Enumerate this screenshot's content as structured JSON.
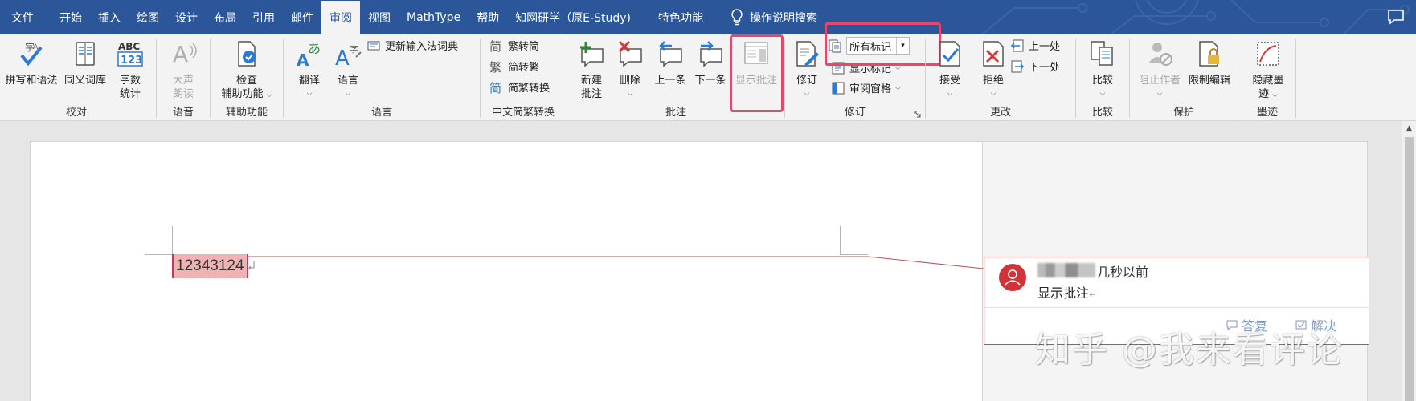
{
  "tabs": [
    {
      "label": "文件",
      "active": false
    },
    {
      "label": "开始",
      "active": false
    },
    {
      "label": "插入",
      "active": false
    },
    {
      "label": "绘图",
      "active": false
    },
    {
      "label": "设计",
      "active": false
    },
    {
      "label": "布局",
      "active": false
    },
    {
      "label": "引用",
      "active": false
    },
    {
      "label": "邮件",
      "active": false
    },
    {
      "label": "审阅",
      "active": true
    },
    {
      "label": "视图",
      "active": false
    },
    {
      "label": "MathType",
      "active": false
    },
    {
      "label": "帮助",
      "active": false
    },
    {
      "label": "知网研学（原E-Study)",
      "active": false
    },
    {
      "label": "特色功能",
      "active": false
    }
  ],
  "tell_me": "操作说明搜索",
  "ribbon": {
    "proofing": {
      "label": "校对",
      "spelling": "拼写和语法",
      "thesaurus": "同义词库",
      "wordcount_1": "字数",
      "wordcount_2": "统计"
    },
    "speech": {
      "label": "语音",
      "read_1": "大声",
      "read_2": "朗读"
    },
    "accessibility": {
      "label": "辅助功能",
      "check_1": "检查",
      "check_2": "辅助功能"
    },
    "language": {
      "label": "语言",
      "translate": "翻译",
      "language": "语言",
      "update_ime": "更新输入法词典"
    },
    "chinese": {
      "label": "中文简繁转换",
      "to_simplified": "繁转简",
      "to_traditional": "简转繁",
      "convert": "简繁转换"
    },
    "comments": {
      "label": "批注",
      "new_1": "新建",
      "new_2": "批注",
      "delete": "删除",
      "previous": "上一条",
      "next": "下一条",
      "show": "显示批注"
    },
    "tracking": {
      "label": "修订",
      "track": "修订",
      "markup_value": "所有标记",
      "show_markup": "显示标记",
      "reviewing_pane": "审阅窗格"
    },
    "changes": {
      "label": "更改",
      "accept": "接受",
      "reject": "拒绝",
      "previous": "上一处",
      "next": "下一处"
    },
    "compare": {
      "label": "比较",
      "compare": "比较"
    },
    "protect": {
      "label": "保护",
      "block_authors": "阻止作者",
      "restrict": "限制编辑"
    },
    "ink": {
      "label": "墨迹",
      "hide_1": "隐藏墨",
      "hide_2": "迹"
    }
  },
  "document": {
    "text": "12343124",
    "comment": {
      "time": "几秒以前",
      "text": "显示批注",
      "reply": "答复",
      "resolve": "解决"
    }
  },
  "watermark": "知乎 @我来看评论",
  "colors": {
    "ribbon_blue": "#2b579a",
    "highlight_box": "#e8476b",
    "comment_border": "#cd4a4a",
    "avatar": "#d13438"
  }
}
